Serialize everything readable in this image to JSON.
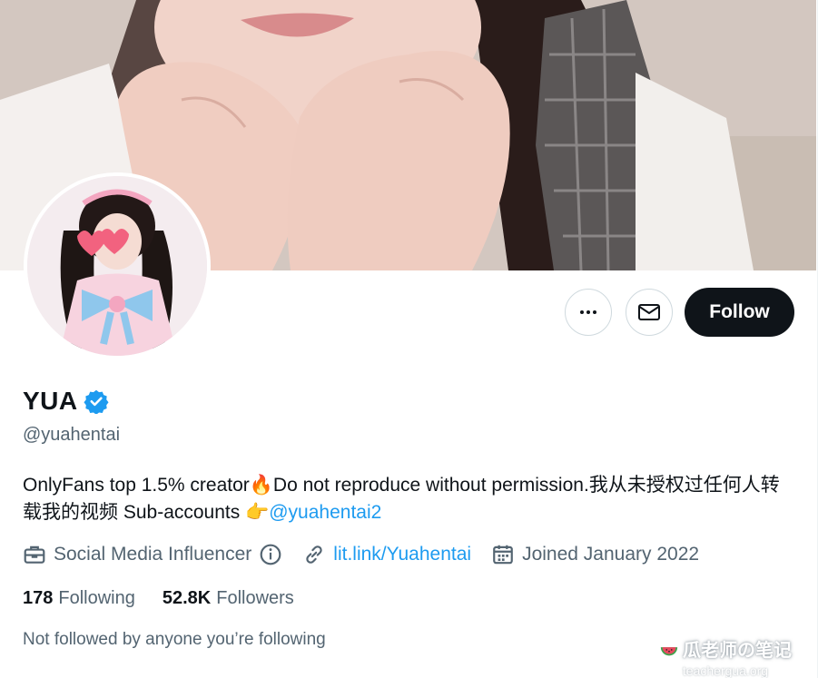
{
  "profile": {
    "display_name": "YUA",
    "handle": "@yuahentai",
    "bio_text": "OnlyFans top 1.5% creator🔥Do not reproduce without permission.我从未授权过任何人转载我的视频 Sub-accounts 👉",
    "bio_link": "@yuahentai2",
    "category": "Social Media Influencer",
    "website": "lit.link/Yuahentai",
    "joined": "Joined January 2022"
  },
  "stats": {
    "following_count": "178",
    "following_label": "Following",
    "followers_count": "52.8K",
    "followers_label": "Followers"
  },
  "actions": {
    "follow_label": "Follow"
  },
  "not_followed_text": "Not followed by anyone you’re following",
  "watermark": {
    "title": "瓜老师の笔记",
    "subtitle": "teachergua.org"
  },
  "colors": {
    "accent": "#1d9bf0",
    "text_primary": "#0f1419",
    "text_secondary": "#536471",
    "follow_button": "#0f1419"
  }
}
